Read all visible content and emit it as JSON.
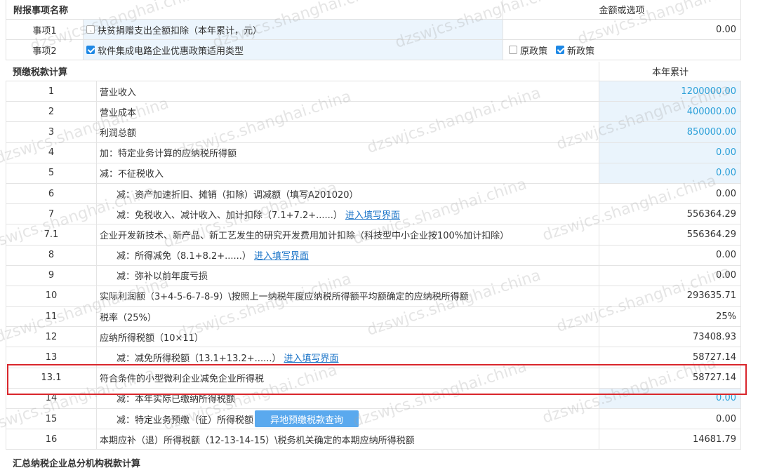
{
  "attach": {
    "header_name": "附报事项名称",
    "header_value": "金额或选项",
    "items": [
      {
        "no": "事项1",
        "label": "扶贫捐赠支出全额扣除（本年累计，元）",
        "checked": false,
        "value": "0.00"
      },
      {
        "no": "事项2",
        "label": "软件集成电路企业优惠政策适用类型",
        "checked": true,
        "opt_old": "原政策",
        "opt_old_checked": false,
        "opt_new": "新政策",
        "opt_new_checked": true
      }
    ]
  },
  "prepay": {
    "title": "预缴税款计算",
    "col_value": "本年累计",
    "rows": [
      {
        "no": "1",
        "desc": "营业收入",
        "value": "1200000.00",
        "editable": true
      },
      {
        "no": "2",
        "desc": "营业成本",
        "value": "400000.00",
        "editable": true
      },
      {
        "no": "3",
        "desc": "利润总额",
        "value": "850000.00",
        "editable": true
      },
      {
        "no": "4",
        "desc": "加：特定业务计算的应纳税所得额",
        "value": "0.00",
        "editable": true
      },
      {
        "no": "5",
        "desc": "减：不征税收入",
        "value": "0.00",
        "editable": true
      },
      {
        "no": "6",
        "desc": "减：资产加速折旧、摊销（扣除）调减额（填写A201020）",
        "value": "0.00",
        "indent": true
      },
      {
        "no": "7",
        "desc": "减：免税收入、减计收入、加计扣除（7.1+7.2+......）",
        "link": "进入填写界面",
        "value": "556364.29",
        "indent": true
      },
      {
        "no": "7.1",
        "desc": "企业开发新技术、新产品、新工艺发生的研究开发费用加计扣除（科技型中小企业按100%加计扣除）",
        "value": "556364.29"
      },
      {
        "no": "8",
        "desc": "减：所得减免（8.1+8.2+......）",
        "link": "进入填写界面",
        "value": "0.00",
        "indent": true
      },
      {
        "no": "9",
        "desc": "减：弥补以前年度亏损",
        "value": "0.00",
        "indent": true
      },
      {
        "no": "10",
        "desc": "实际利润额（3+4-5-6-7-8-9）\\按照上一纳税年度应纳税所得额平均额确定的应纳税所得额",
        "value": "293635.71"
      },
      {
        "no": "11",
        "desc": "税率（25%）",
        "value": "25%"
      },
      {
        "no": "12",
        "desc": "应纳所得税额（10×11）",
        "value": "73408.93"
      },
      {
        "no": "13",
        "desc": "减：减免所得税额（13.1+13.2+......）",
        "link": "进入填写界面",
        "value": "58727.14",
        "indent": true
      },
      {
        "no": "13.1",
        "desc": "符合条件的小型微利企业减免企业所得税",
        "value": "58727.14"
      },
      {
        "no": "14",
        "desc": "减：本年实际已缴纳所得税额",
        "value": "0.00",
        "editable": true,
        "indent": true
      },
      {
        "no": "15",
        "desc": "减：特定业务预缴（征）所得税额",
        "button": "异地预缴税款查询",
        "value": "0.00",
        "indent": true
      },
      {
        "no": "16",
        "desc": "本期应补（退）所得税额（12-13-14-15）\\税务机关确定的本期应纳所得税额",
        "value": "14681.79"
      }
    ]
  },
  "footer_title": "汇总纳税企业总分机构税款计算",
  "watermark": "dzswjcs.shanghai.china"
}
